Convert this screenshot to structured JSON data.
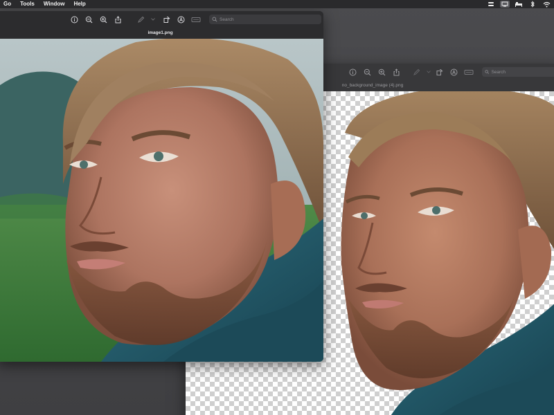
{
  "menubar": {
    "items": [
      "Go",
      "Tools",
      "Window",
      "Help"
    ],
    "status_icons": [
      "launcher-icon",
      "display-icon",
      "bed-icon",
      "bluetooth-icon",
      "wifi-icon"
    ]
  },
  "front_window": {
    "title": "image1.png",
    "search_placeholder": "Search",
    "toolbar_icons": [
      "info-icon",
      "zoom-out-icon",
      "zoom-in-icon",
      "share-icon",
      "markup-pen-icon",
      "chevron-down-icon",
      "rotate-icon",
      "markup-circle-icon",
      "redact-box-icon"
    ]
  },
  "back_window": {
    "title": "no_background_image (4).png",
    "search_placeholder": "Search",
    "toolbar_icons": [
      "info-icon",
      "zoom-out-icon",
      "zoom-in-icon",
      "share-icon",
      "markup-pen-icon",
      "chevron-down-icon",
      "rotate-icon",
      "markup-circle-icon",
      "redact-box-icon"
    ]
  },
  "colors": {
    "menubar": "#2a2a2c",
    "toolbar": "#2c2c2e",
    "scarf": "#1f5566",
    "skin": "#b27c63",
    "hair": "#8a6a4a",
    "grass": "#3c7a3c"
  }
}
